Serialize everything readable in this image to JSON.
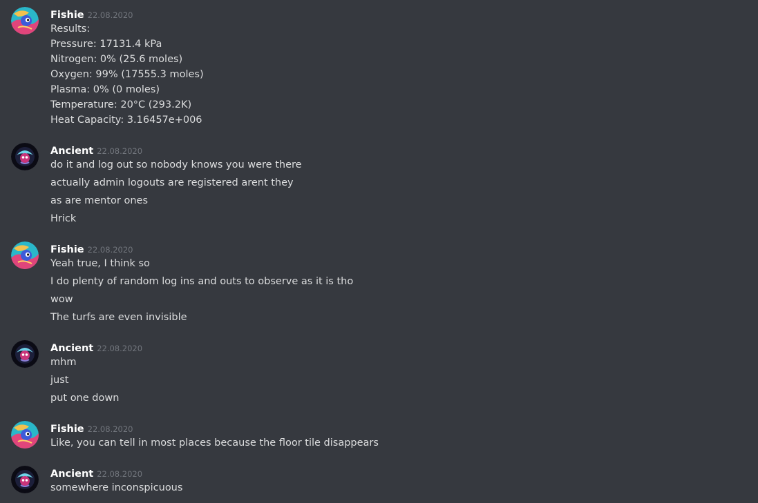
{
  "colors": {
    "background": "#36393f",
    "username": "#ffffff",
    "timestamp": "#72767d",
    "message_text": "#dcddde"
  },
  "messages": [
    {
      "author": "Fishie",
      "avatar_icon": "fishie-avatar-icon",
      "timestamp": "22.08.2020",
      "lines": [
        "Results:",
        "Pressure: 17131.4 kPa",
        "Nitrogen: 0% (25.6 moles)",
        "Oxygen: 99% (17555.3 moles)",
        "Plasma: 0% (0 moles)",
        "Temperature: 20°C (293.2K)",
        "Heat Capacity: 3.16457e+006"
      ]
    },
    {
      "author": "Ancient",
      "avatar_icon": "ancient-avatar-icon",
      "timestamp": "22.08.2020",
      "lines": [
        "do it and log out so nobody knows you were there",
        "actually admin logouts are registered arent they",
        "as are mentor ones",
        "Hrick"
      ]
    },
    {
      "author": "Fishie",
      "avatar_icon": "fishie-avatar-icon",
      "timestamp": "22.08.2020",
      "lines": [
        "Yeah true, I think so",
        "I do plenty of random log ins and outs to observe as it is tho",
        "wow",
        "The turfs are even invisible"
      ]
    },
    {
      "author": "Ancient",
      "avatar_icon": "ancient-avatar-icon",
      "timestamp": "22.08.2020",
      "lines": [
        "mhm",
        "just",
        "put one down"
      ]
    },
    {
      "author": "Fishie",
      "avatar_icon": "fishie-avatar-icon",
      "timestamp": "22.08.2020",
      "lines": [
        "Like, you can tell in most places because the floor tile disappears"
      ]
    },
    {
      "author": "Ancient",
      "avatar_icon": "ancient-avatar-icon",
      "timestamp": "22.08.2020",
      "lines": [
        "somewhere inconspicuous"
      ]
    }
  ]
}
